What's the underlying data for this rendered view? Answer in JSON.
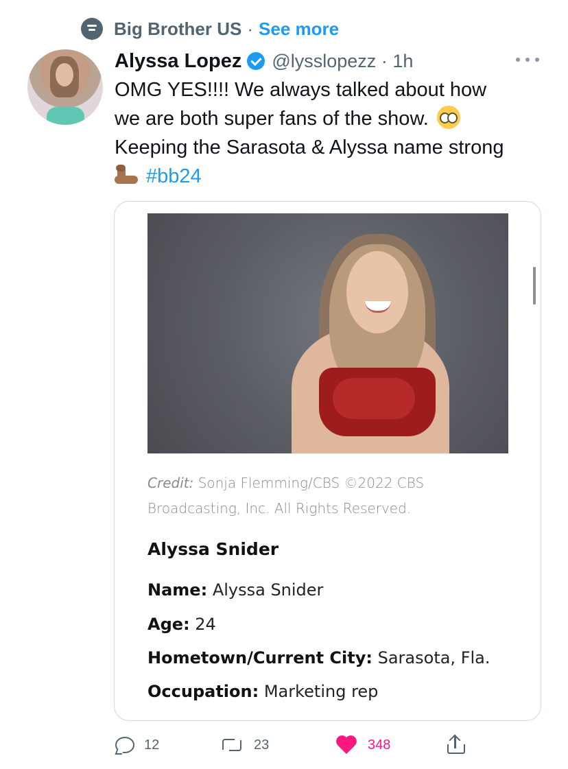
{
  "topic": {
    "label": "Big Brother US",
    "separator": "·",
    "see_more": "See more"
  },
  "author": {
    "name": "Alyssa Lopez",
    "handle": "@lysslopezz",
    "separator": "·",
    "time": "1h"
  },
  "tweet": {
    "line1": "OMG YES!!!! We always talked about how",
    "line2": "we are both super fans of the show.",
    "line3": "Keeping the Sarasota & Alyssa name strong",
    "hashtag": "#bb24",
    "emoji": [
      "pleading-face-emoji",
      "flexed-biceps-emoji"
    ]
  },
  "card": {
    "credit_label": "Credit:",
    "credit_line1": "Sonja Flemming/CBS ©2022 CBS",
    "credit_line2": "Broadcasting, Inc. All Rights Reserved.",
    "title": "Alyssa Snider",
    "fields": [
      {
        "label": "Name:",
        "value": "Alyssa Snider"
      },
      {
        "label": "Age:",
        "value": "24"
      },
      {
        "label": "Hometown/Current City:",
        "value": "Sarasota, Fla."
      },
      {
        "label": "Occupation:",
        "value": "Marketing rep"
      }
    ]
  },
  "actions": {
    "replies": "12",
    "retweets": "23",
    "likes": "348"
  },
  "colors": {
    "accent": "#1d9bf0",
    "like": "#f91880",
    "muted": "#536471"
  },
  "icons": [
    "topic-icon",
    "verified-icon",
    "more-icon",
    "reply-icon",
    "retweet-icon",
    "like-icon",
    "share-icon"
  ]
}
